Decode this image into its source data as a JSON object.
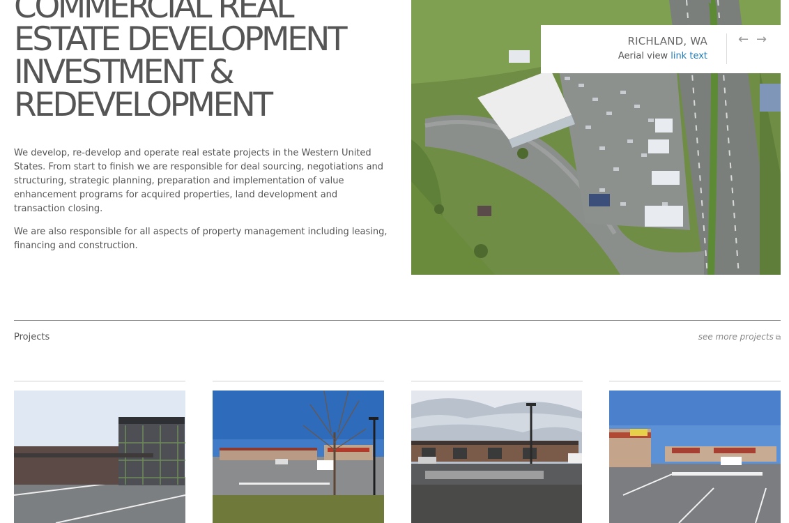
{
  "hero": {
    "title_lines": [
      "COMMERCIAL REAL",
      "ESTATE DEVELOPMENT",
      "INVESTMENT &",
      "REDEVELOPMENT"
    ],
    "paragraph1": "We develop, re-develop and operate real estate projects in the Western United States. From start to finish we are responsible for deal sourcing, negotiations and structuring, strategic planning, preparation and implementation of value enhancement programs for acquired properties, land development and transaction closing.",
    "paragraph2": "We are also responsible for all aspects of property management including leasing, financing and construction."
  },
  "slider": {
    "caption_title": "RICHLAND, WA",
    "caption_sub": "Aerial view",
    "caption_link": "link text",
    "prev_glyph": "←",
    "next_glyph": "→",
    "image_icon": "aerial-photo"
  },
  "projects": {
    "label": "Projects",
    "see_more": "see more projects",
    "see_more_icon": "external-link-icon",
    "thumbnails": [
      "construction-photo",
      "shopping-center-tree-photo",
      "parking-lot-lamp-photo",
      "strip-mall-photo"
    ]
  },
  "colors": {
    "title": "#555555",
    "link": "#1f7ab5",
    "rule": "#8a8a8a"
  }
}
